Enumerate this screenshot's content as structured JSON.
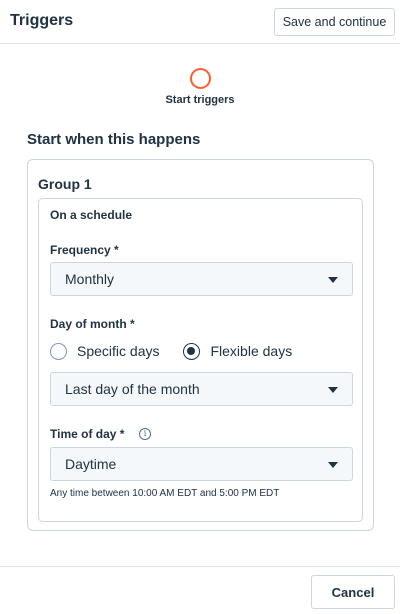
{
  "header": {
    "title": "Triggers",
    "save_label": "Save and continue"
  },
  "step": {
    "label": "Start triggers",
    "accent_color": "#ff5c35"
  },
  "section": {
    "title": "Start when this happens"
  },
  "group": {
    "title": "Group 1",
    "schedule": {
      "title": "On a schedule",
      "frequency": {
        "label": "Frequency *",
        "value": "Monthly"
      },
      "day_of_month": {
        "label": "Day of month *",
        "options": [
          {
            "label": "Specific days",
            "checked": false
          },
          {
            "label": "Flexible days",
            "checked": true
          }
        ],
        "value": "Last day of the month"
      },
      "time_of_day": {
        "label": "Time of day *",
        "info_icon": "info-icon",
        "value": "Daytime",
        "helper": "Any time between 10:00 AM EDT and 5:00 PM EDT"
      }
    }
  },
  "footer": {
    "cancel_label": "Cancel"
  }
}
